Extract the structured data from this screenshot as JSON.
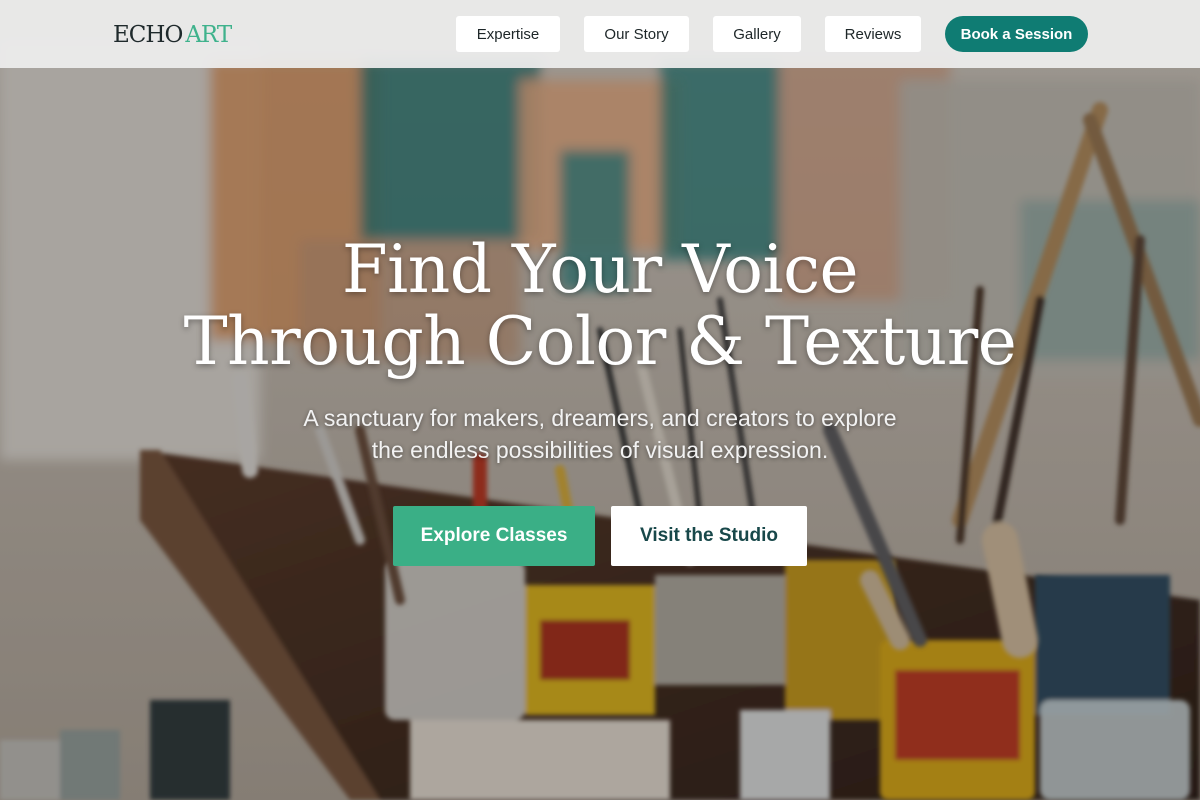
{
  "brand": {
    "logo_part1": "ECHO",
    "logo_part2": "ART",
    "accent_color": "#3fb28c"
  },
  "nav": {
    "items": [
      {
        "label": "Expertise"
      },
      {
        "label": "Our Story"
      },
      {
        "label": "Gallery"
      },
      {
        "label": "Reviews"
      }
    ],
    "cta_label": "Book a Session",
    "cta_color": "#0f7c73"
  },
  "hero": {
    "headline_line1": "Find Your Voice",
    "headline_line2": "Through Color & Texture",
    "subtext_line1": "A sanctuary for makers, dreamers, and creators to explore",
    "subtext_line2": "the endless possibilities of visual expression.",
    "primary_button": "Explore Classes",
    "secondary_button": "Visit the Studio",
    "primary_color": "#3aaf86",
    "background_image": "art-studio-paint-supplies-photo"
  }
}
